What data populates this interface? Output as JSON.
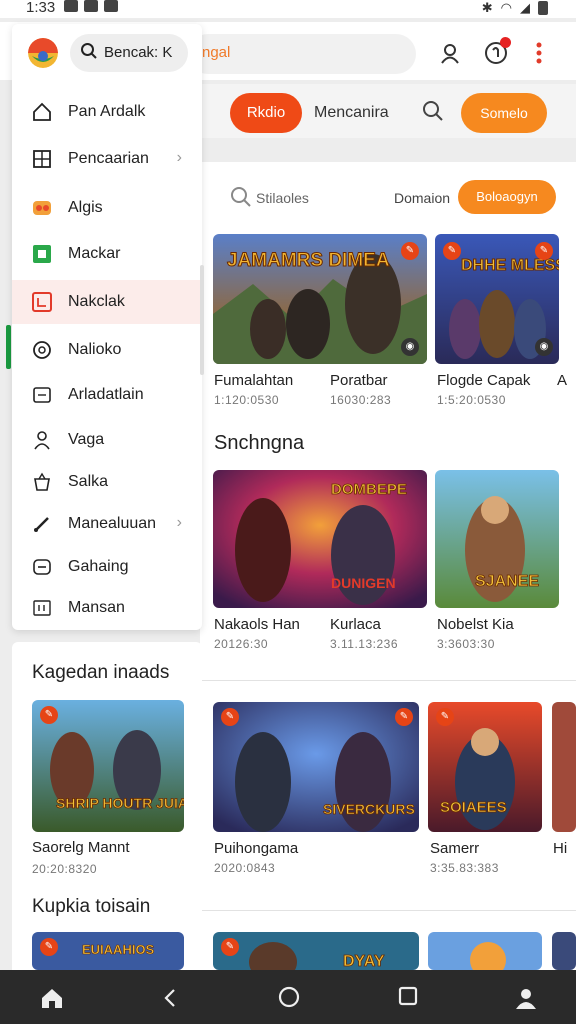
{
  "status": {
    "time": "1:33"
  },
  "header": {
    "search_text": "ngal",
    "icons": [
      "user-icon",
      "notification-icon",
      "more-icon"
    ]
  },
  "navbar": {
    "pill_red": "Rkdio",
    "text": "Mencanira",
    "pill_orange": "Somelo"
  },
  "filter": {
    "search_text": "Stilaoles",
    "domain_text": "Domaion",
    "button": "Boloaogyn"
  },
  "drawer": {
    "search_text": "Bencak: K",
    "items": [
      {
        "label": "Pan Ardalk",
        "icon": "home-icon"
      },
      {
        "label": "Pencaarian",
        "icon": "grid-icon",
        "chevron": "›"
      },
      {
        "label": "Algis",
        "icon": "puzzle-icon"
      },
      {
        "label": "Mackar",
        "icon": "green-square-icon"
      },
      {
        "label": "Nakclak",
        "icon": "red-square-icon"
      },
      {
        "label": "Nalioko",
        "icon": "shield-icon"
      },
      {
        "label": "Arladatlain",
        "icon": "card-icon"
      },
      {
        "label": "Vaga",
        "icon": "person-icon"
      },
      {
        "label": "Salka",
        "icon": "bag-icon"
      },
      {
        "label": "Manealuuan",
        "icon": "pen-icon",
        "chevron": "›"
      },
      {
        "label": "Gahaing",
        "icon": "gamepad-icon"
      },
      {
        "label": "Mansan",
        "icon": "book-icon"
      }
    ]
  },
  "row1": [
    {
      "title": "Fumalahtan",
      "meta": "1:120:0530",
      "art_text": "JAMAMRS DIMEA"
    },
    {
      "title": "Poratbar",
      "meta": "16030:283",
      "art_text": ""
    },
    {
      "title": "Flogde Capak",
      "meta": "1:5:20:0530",
      "art_text": "DHHE MLESS"
    },
    {
      "title": "A",
      "meta": "",
      "art_text": ""
    }
  ],
  "section_title": "Snchngna",
  "row2": [
    {
      "title": "Nakaols Han",
      "meta": "20126:30",
      "art_text": "DOMBEPE"
    },
    {
      "title": "Kurlaca",
      "meta": "3.11.13:236",
      "art_text": "DUNIGEN"
    },
    {
      "title": "Nobelst Kia",
      "meta": "3:3603:30",
      "art_text": "SJANEE"
    }
  ],
  "row3": [
    {
      "title": "Puihongama",
      "meta": "2020:0843",
      "art_text": "SIVERCKURS"
    },
    {
      "title": "Samerr",
      "meta": "3:35.83:383",
      "art_text": "SOIAEES"
    },
    {
      "title": "Hi",
      "meta": "",
      "art_text": ""
    }
  ],
  "left_panel": {
    "title": "Kagedan inaads",
    "card_title": "Saorelg Mannt",
    "card_meta": "20:20:8320",
    "art_text": "SHRIP HOUTR JUIAYS",
    "title2": "Kupkia toisain",
    "art_text2": "EUIAAHIOS"
  },
  "row4": [
    {
      "art_text": ""
    },
    {
      "art_text": "DYAY"
    },
    {
      "art_text": ""
    }
  ],
  "colors": {
    "accent_red": "#ef4a16",
    "accent_orange": "#f6891f"
  },
  "bottom_nav": [
    "home-icon",
    "back-icon",
    "home-circle-icon",
    "recents-icon",
    "profile-icon"
  ]
}
